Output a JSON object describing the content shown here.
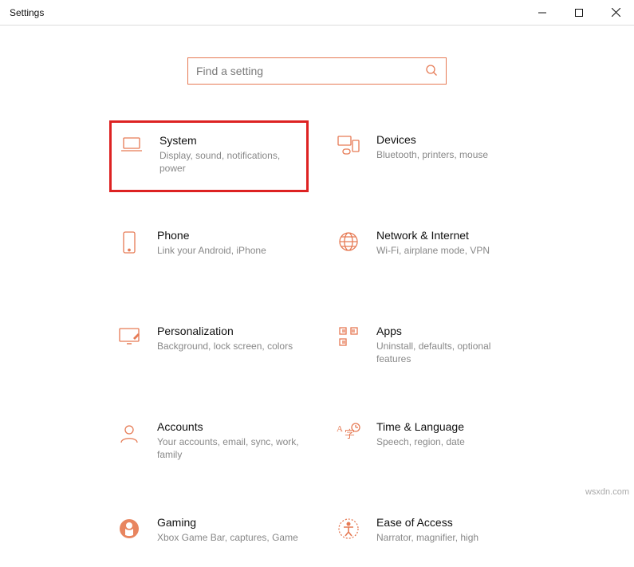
{
  "window": {
    "title": "Settings"
  },
  "search": {
    "placeholder": "Find a setting"
  },
  "cards": [
    {
      "title": "System",
      "desc": "Display, sound, notifications, power",
      "highlight": true
    },
    {
      "title": "Devices",
      "desc": "Bluetooth, printers, mouse"
    },
    {
      "title": "Phone",
      "desc": "Link your Android, iPhone"
    },
    {
      "title": "Network & Internet",
      "desc": "Wi-Fi, airplane mode, VPN"
    },
    {
      "title": "Personalization",
      "desc": "Background, lock screen, colors"
    },
    {
      "title": "Apps",
      "desc": "Uninstall, defaults, optional features"
    },
    {
      "title": "Accounts",
      "desc": "Your accounts, email, sync, work, family"
    },
    {
      "title": "Time & Language",
      "desc": "Speech, region, date"
    },
    {
      "title": "Gaming",
      "desc": "Xbox Game Bar, captures, Game"
    },
    {
      "title": "Ease of Access",
      "desc": "Narrator, magnifier, high"
    }
  ],
  "watermark": "wsxdn.com"
}
